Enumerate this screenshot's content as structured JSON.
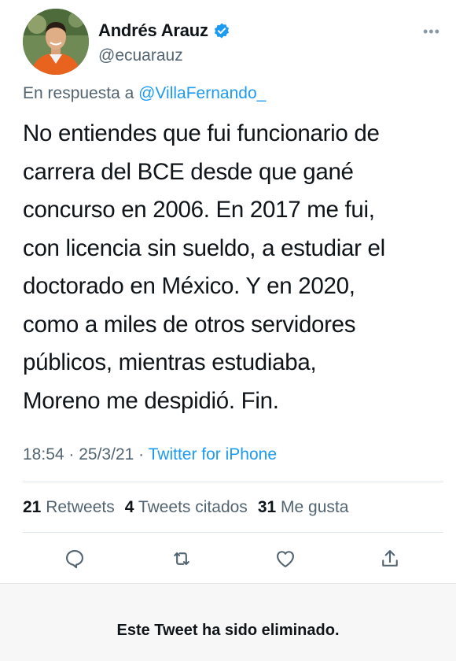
{
  "author": {
    "display_name": "Andrés Arauz",
    "handle": "@ecuarauz",
    "verified": true
  },
  "reply": {
    "prefix": "En respuesta a",
    "mention": "@VillaFernando_"
  },
  "tweet": {
    "lines": [
      "No entiendes que fui funcionario de",
      "carrera del BCE desde que gané",
      "concurso en 2006. En 2017 me fui,",
      "con licencia sin sueldo, a estudiar el",
      "doctorado en México. Y en 2020,",
      "como a miles de otros servidores",
      "públicos, mientras estudiaba,",
      "Moreno me despidió. Fin."
    ],
    "time": "18:54",
    "date": "25/3/21",
    "source": "Twitter for iPhone"
  },
  "stats": {
    "retweets_count": "21",
    "retweets_label": "Retweets",
    "quotes_count": "4",
    "quotes_label": "Tweets citados",
    "likes_count": "31",
    "likes_label": "Me gusta"
  },
  "actions": [
    "reply-icon",
    "retweet-icon",
    "like-icon",
    "share-icon"
  ],
  "more_label": "•••",
  "deleted_notice": "Este Tweet ha sido eliminado.",
  "colors": {
    "accent": "#1d9bf0",
    "secondary_text": "#536471",
    "primary_text": "#0f1419",
    "banner_bg": "#f7f7f8"
  }
}
